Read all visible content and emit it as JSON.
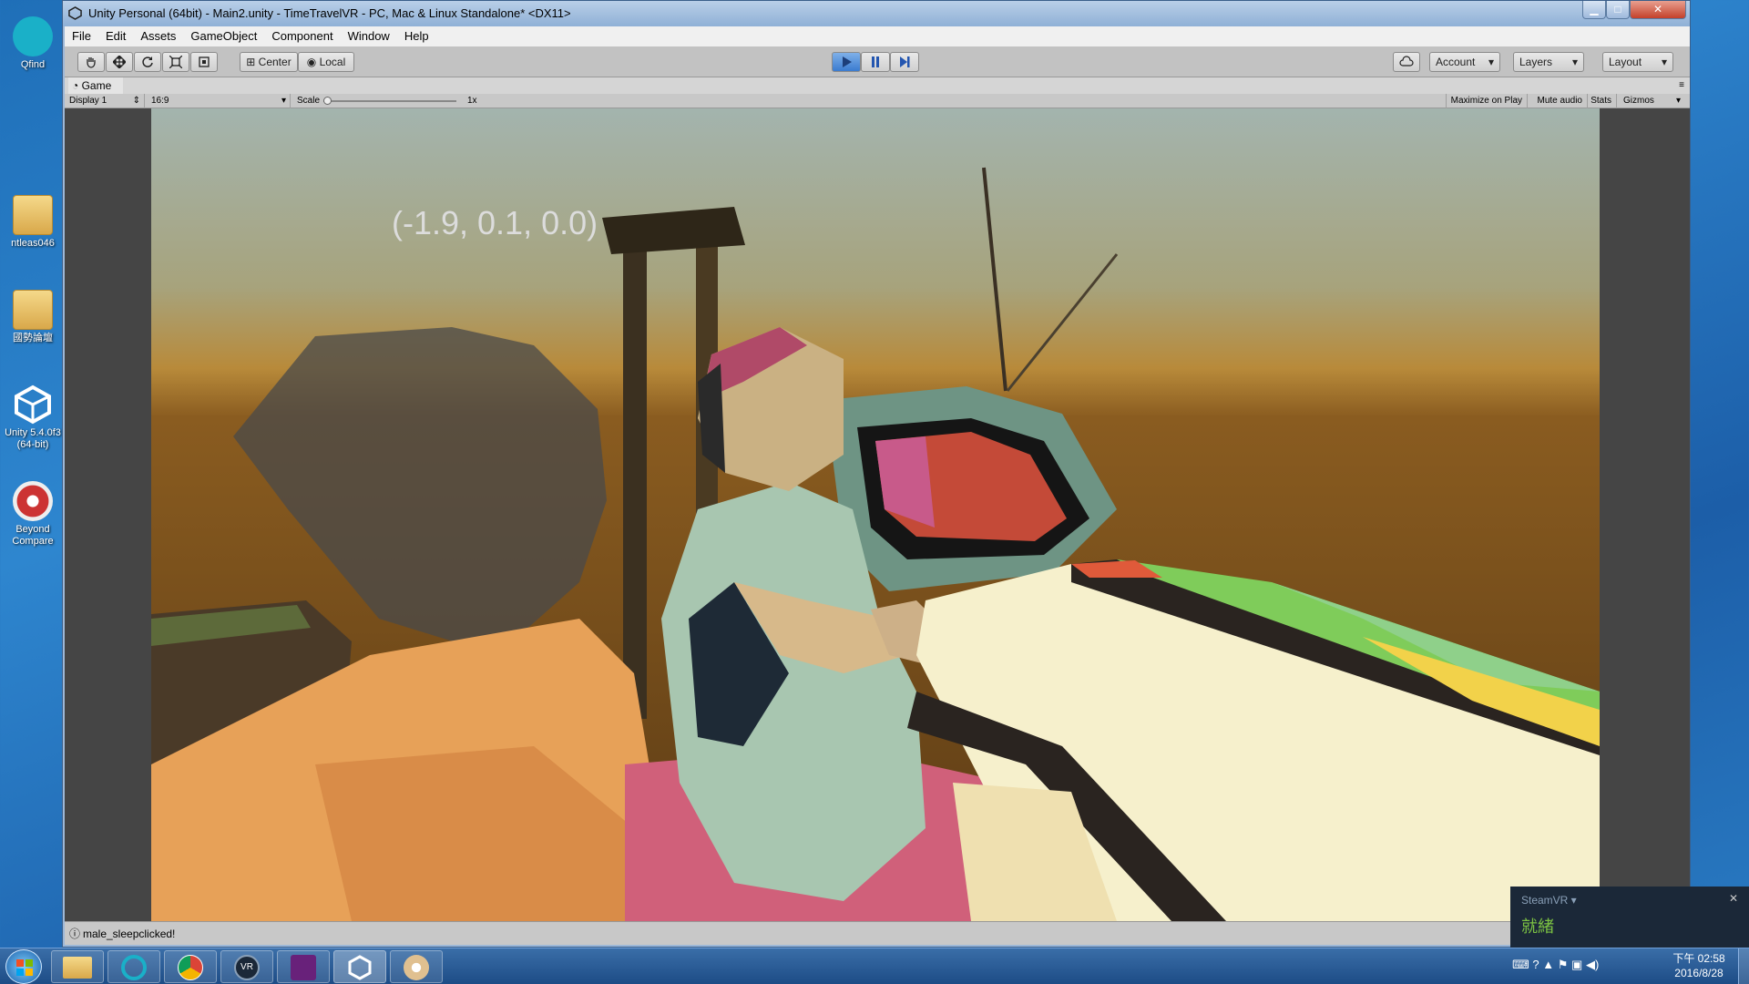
{
  "desktop": {
    "icons": [
      {
        "label": "Qfind"
      },
      {
        "label": "ntleas046"
      },
      {
        "label": "國勢論壇"
      },
      {
        "label": "Unity 5.4.0f3 (64-bit)"
      },
      {
        "label": "Beyond Compare"
      }
    ]
  },
  "window": {
    "title": "Unity Personal (64bit) - Main2.unity - TimeTravelVR - PC, Mac & Linux Standalone* <DX11>",
    "minimize": "▁",
    "maximize": "□",
    "close": "✕"
  },
  "menu": [
    "File",
    "Edit",
    "Assets",
    "GameObject",
    "Component",
    "Window",
    "Help"
  ],
  "toolbar": {
    "pivot": "Center",
    "space": "Local",
    "account": "Account",
    "layers": "Layers",
    "layout": "Layout"
  },
  "game_panel": {
    "tab": "Game",
    "display": "Display 1",
    "aspect": "16:9",
    "scale_label": "Scale",
    "scale_value": "1x",
    "maximize_on_play": "Maximize on Play",
    "mute_audio": "Mute audio",
    "stats": "Stats",
    "gizmos": "Gizmos"
  },
  "scene": {
    "coords": "(-1.9, 0.1, 0.0)"
  },
  "status": {
    "message": "male_sleepclicked!"
  },
  "steamvr": {
    "title": "SteamVR ▾",
    "status": "就緒",
    "close": "✕"
  },
  "tray": {
    "time": "下午 02:58",
    "date": "2016/8/28"
  },
  "colors": {
    "accent_blue": "#2e86cf",
    "sky_top": "#9fb3ae",
    "horizon": "#b37a2a",
    "ground": "#6a4418",
    "steam_green": "#7bc142"
  }
}
